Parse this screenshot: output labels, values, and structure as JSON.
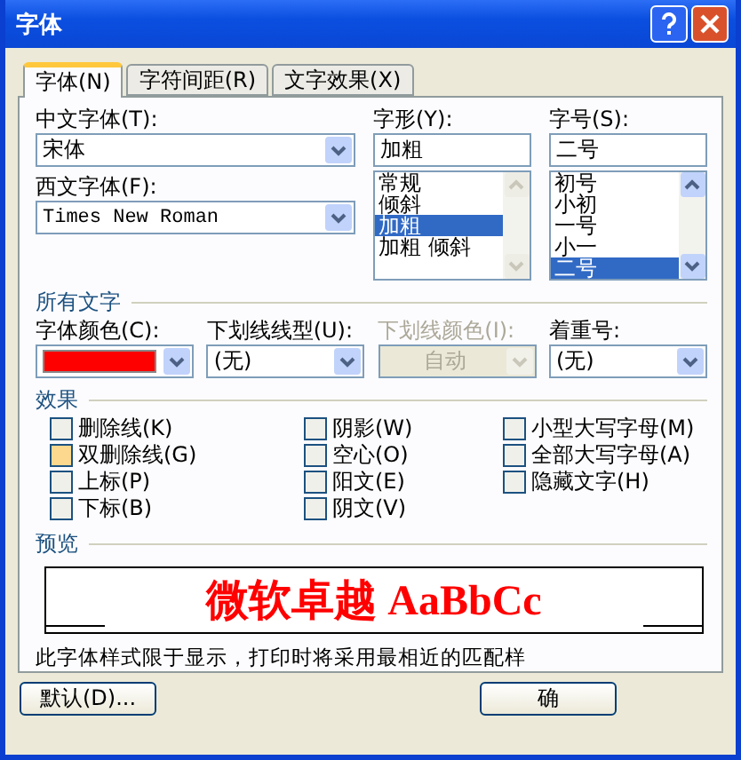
{
  "window": {
    "title": "字体"
  },
  "tabs": [
    {
      "label": "字体(N)",
      "selected": true
    },
    {
      "label": "字符间距(R)",
      "selected": false
    },
    {
      "label": "文字效果(X)",
      "selected": false
    }
  ],
  "chinese_font": {
    "label": "中文字体(T):",
    "value": "宋体"
  },
  "western_font": {
    "label": "西文字体(F):",
    "value": "Times New Roman"
  },
  "style": {
    "label": "字形(Y):",
    "value": "加粗",
    "items": [
      {
        "label": "常规",
        "selected": false
      },
      {
        "label": "倾斜",
        "selected": false
      },
      {
        "label": "加粗",
        "selected": true
      },
      {
        "label": "加粗 倾斜",
        "selected": false
      }
    ]
  },
  "size": {
    "label": "字号(S):",
    "value": "二号",
    "items": [
      {
        "label": "初号",
        "selected": false
      },
      {
        "label": "小初",
        "selected": false
      },
      {
        "label": "一号",
        "selected": false
      },
      {
        "label": "小一",
        "selected": false
      },
      {
        "label": "二号",
        "selected": true
      }
    ]
  },
  "all_text": {
    "title": "所有文字",
    "font_color": {
      "label": "字体颜色(C):",
      "color": "#ff0000"
    },
    "underline_style": {
      "label": "下划线线型(U):",
      "value": "(无)",
      "disabled": false
    },
    "underline_color": {
      "label": "下划线颜色(I):",
      "value": "自动",
      "disabled": true
    },
    "emphasis": {
      "label": "着重号:",
      "value": "(无)",
      "disabled": false
    }
  },
  "effects": {
    "title": "效果",
    "columns": [
      [
        {
          "label": "删除线(K)",
          "checked": false,
          "hovered": false
        },
        {
          "label": "双删除线(G)",
          "checked": false,
          "hovered": true
        },
        {
          "label": "上标(P)",
          "checked": false,
          "hovered": false
        },
        {
          "label": "下标(B)",
          "checked": false,
          "hovered": false
        }
      ],
      [
        {
          "label": "阴影(W)",
          "checked": false,
          "hovered": false
        },
        {
          "label": "空心(O)",
          "checked": false,
          "hovered": false
        },
        {
          "label": "阳文(E)",
          "checked": false,
          "hovered": false
        },
        {
          "label": "阴文(V)",
          "checked": false,
          "hovered": false
        }
      ],
      [
        {
          "label": "小型大写字母(M)",
          "checked": false,
          "hovered": false
        },
        {
          "label": "全部大写字母(A)",
          "checked": false,
          "hovered": false
        },
        {
          "label": "隐藏文字(H)",
          "checked": false,
          "hovered": false
        }
      ]
    ]
  },
  "preview": {
    "title": "预览",
    "sample": "微软卓越 AaBbCc",
    "note": "此字体样式限于显示，打印时将采用最相近的匹配样"
  },
  "buttons": [
    {
      "label": "默认(D)..."
    },
    {
      "label": "确"
    }
  ]
}
